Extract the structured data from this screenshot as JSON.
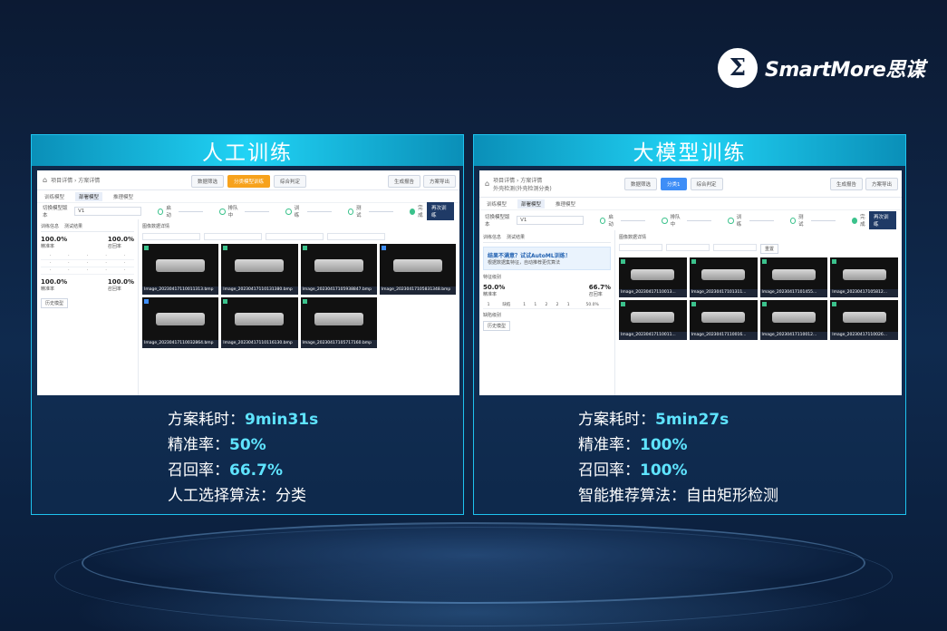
{
  "brand": {
    "logo_mark": "Σ",
    "name": "SmartMore思谋"
  },
  "left": {
    "title": "人工训练",
    "screenshot": {
      "breadcrumb": "项目详情 › 方案详情",
      "top_buttons": [
        "数据筛选",
        "分类模型训练",
        "综合判定",
        "生成报告",
        "方案导出"
      ],
      "tabs": [
        "训练模型",
        "部署模型",
        "推理模型"
      ],
      "model_label": "切换模型版本",
      "model_value": "V1",
      "steps": [
        "启动",
        "排队中",
        "训练",
        "测试",
        "完成"
      ],
      "retrain": "再次训练",
      "sub_tabs": [
        "训练信息",
        "测试结果"
      ],
      "kpis": [
        {
          "value": "100.0%",
          "label": "精准率"
        },
        {
          "value": "100.0%",
          "label": "召回率"
        }
      ],
      "kpis2": [
        {
          "value": "100.0%",
          "label": "精准率"
        },
        {
          "value": "100.0%",
          "label": "召回率"
        }
      ],
      "side_btn": "历史模型",
      "grid_title": "图像数据详情",
      "images": [
        "Image_20230417110011313.bmp",
        "Image_20230417110131380.bmp",
        "Image_20230417105938847.bmp",
        "Image_20230417105831348.bmp",
        "Image_20230417110032864.bmp",
        "Image_20230417110116130.bmp",
        "Image_20230417105717160.bmp"
      ]
    },
    "stats": [
      {
        "label": "方案耗时：",
        "value": "9min31s"
      },
      {
        "label": "精准率：",
        "value": "50%"
      },
      {
        "label": "召回率：",
        "value": "66.7%"
      },
      {
        "label": "人工选择算法：分类",
        "value": ""
      }
    ]
  },
  "right": {
    "title": "大模型训练",
    "screenshot": {
      "breadcrumb": "项目详情 › 方案详情",
      "breadcrumb_sub": "外壳检测(外壳检测分类)",
      "top_buttons": [
        "数据筛选",
        "分类1",
        "综合判定",
        "生成报告",
        "方案导出"
      ],
      "tabs": [
        "训练模型",
        "部署模型",
        "推理模型"
      ],
      "model_label": "切换模型版本",
      "model_value": "V1",
      "steps": [
        "启动",
        "排队中",
        "训练",
        "测试",
        "完成"
      ],
      "retrain": "再次训练",
      "sub_tabs": [
        "训练信息",
        "测试结果"
      ],
      "banner_title": "结果不满意？试试AutoML训练！",
      "banner_text": "根据数据集特征，自动推荐更优算法",
      "section": "特征级别",
      "kpis": [
        {
          "value": "50.0%",
          "label": "精准率"
        },
        {
          "value": "66.7%",
          "label": "召回率"
        }
      ],
      "table_row": [
        "1",
        "缺陷",
        "1",
        "1",
        "2",
        "2",
        "1",
        "50.0%"
      ],
      "section2": "缺陷级别",
      "side_btn": "历史模型",
      "grid_title": "图像数据详情",
      "filter_btn": "重置",
      "images": [
        "Image_20230417110013...",
        "Image_20230417101311...",
        "Image_20230417101455...",
        "Image_20230417105812...",
        "Image_20230417110011...",
        "Image_20230417110016...",
        "Image_20230417110012...",
        "Image_20230417110026..."
      ]
    },
    "stats": [
      {
        "label": "方案耗时：",
        "value": "5min27s"
      },
      {
        "label": "精准率：",
        "value": "100%"
      },
      {
        "label": "召回率：",
        "value": "100%"
      },
      {
        "label": "智能推荐算法：自由矩形检测",
        "value": ""
      }
    ]
  }
}
